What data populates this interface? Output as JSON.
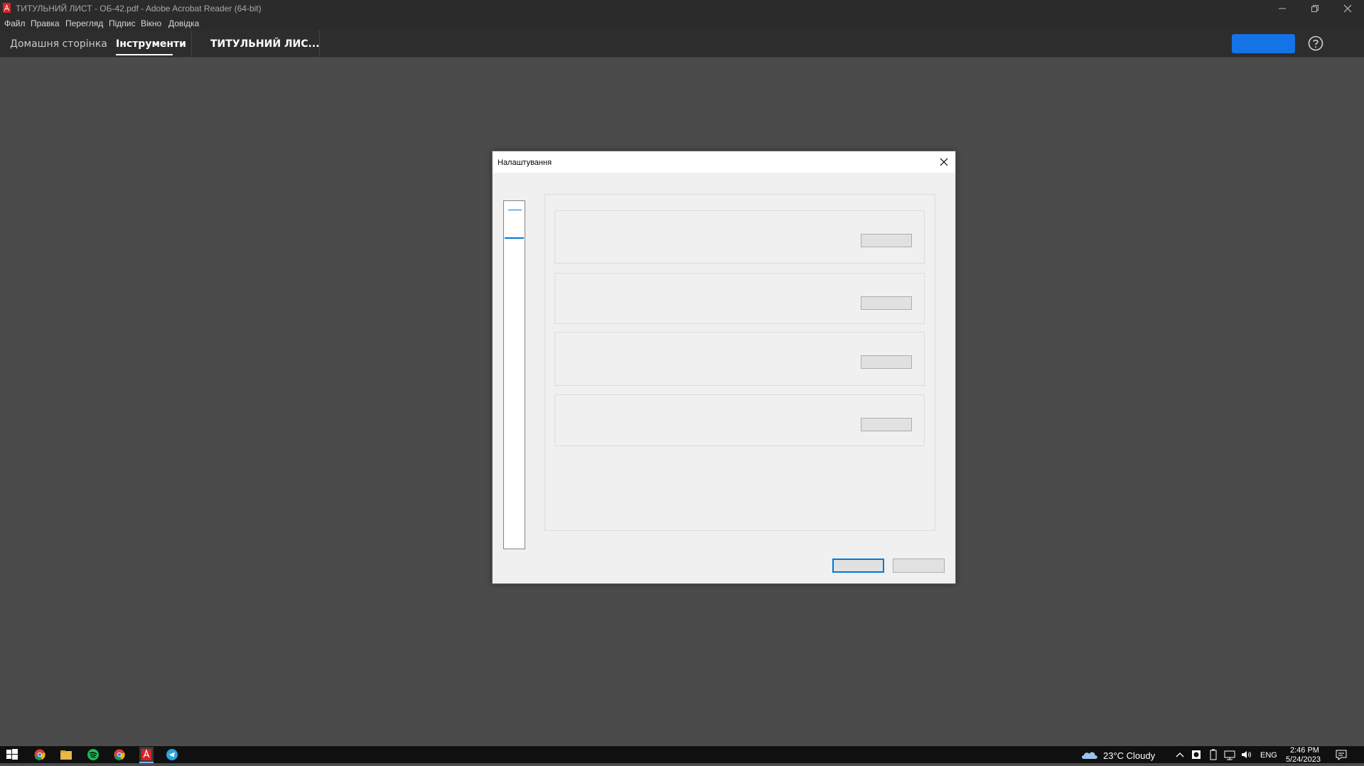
{
  "window": {
    "title": "ТИТУЛЬНИЙ ЛИСТ - ОБ-42.pdf - Adobe Acrobat Reader (64-bit)"
  },
  "menu": {
    "items": [
      "Файл",
      "Правка",
      "Перегляд",
      "Підпис",
      "Вікно",
      "Довідка"
    ]
  },
  "tabs": {
    "home": "Домашня сторінка",
    "tools": "Інструменти",
    "document": "ТИТУЛЬНИЙ ЛИС..."
  },
  "dialog": {
    "title": "Налаштування",
    "groups": 4
  },
  "taskbar": {
    "weather": "23°C  Cloudy",
    "language": "ENG",
    "time": "2:46 PM",
    "date": "5/24/2023"
  },
  "colors": {
    "accent": "#1473e6",
    "focus": "#0078d7",
    "background": "#4b4b4b"
  },
  "icons": [
    "acrobat-icon",
    "minimize-icon",
    "restore-icon",
    "close-icon",
    "help-icon",
    "windows-start-icon",
    "chrome-icon",
    "file-explorer-icon",
    "spotify-icon",
    "acrobat-taskbar-icon",
    "telegram-icon",
    "cloud-icon",
    "chevron-up-icon",
    "notification-icon"
  ]
}
